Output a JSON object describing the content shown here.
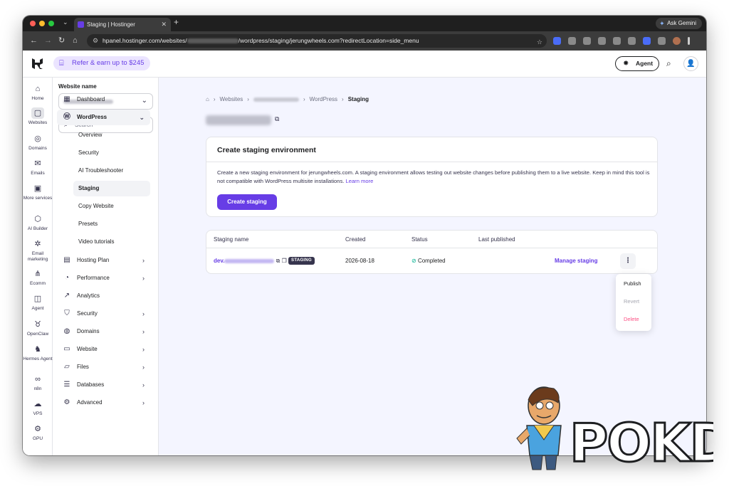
{
  "browser": {
    "tab_title": "Staging | Hostinger",
    "url_prefix": "hpanel.hostinger.com/websites/",
    "url_suffix": "/wordpress/staging/jerungwheels.com?redirectLocation=side_menu",
    "gemini_label": "Ask Gemini",
    "traffic_colors": [
      "#ff5f57",
      "#febc2e",
      "#28c840"
    ]
  },
  "header": {
    "refer_label": "Refer & earn up to $245",
    "agent_label": "Agent"
  },
  "rail": [
    {
      "label": "Home",
      "icon": "home-icon",
      "glyph": "⌂"
    },
    {
      "label": "Websites",
      "icon": "websites-icon",
      "glyph": "▢",
      "active": true
    },
    {
      "label": "Domains",
      "icon": "globe-icon",
      "glyph": "◎"
    },
    {
      "label": "Emails",
      "icon": "mail-icon",
      "glyph": "✉"
    },
    {
      "label": "More services",
      "icon": "box-icon",
      "glyph": "▣"
    },
    {
      "label": "AI Builder",
      "icon": "ai-builder-icon",
      "glyph": "⬡"
    },
    {
      "label": "Email marketing",
      "icon": "email-marketing-icon",
      "glyph": "✲"
    },
    {
      "label": "Ecomm",
      "icon": "ecomm-icon",
      "glyph": "⋔"
    },
    {
      "label": "Agent",
      "icon": "agent-icon",
      "glyph": "◫"
    },
    {
      "label": "OpenClaw",
      "icon": "openclaw-icon",
      "glyph": "♉"
    },
    {
      "label": "Hermes Agent",
      "icon": "hermes-icon",
      "glyph": "♞"
    },
    {
      "label": "n8n",
      "icon": "n8n-icon",
      "glyph": "∞"
    },
    {
      "label": "VPS",
      "icon": "vps-icon",
      "glyph": "☁"
    },
    {
      "label": "GPU",
      "icon": "gpu-icon",
      "glyph": "⚙"
    }
  ],
  "sidebar": {
    "website_label": "Website name",
    "search_placeholder": "Search",
    "items": [
      {
        "label": "Dashboard",
        "icon": "dashboard-icon",
        "glyph": "▦"
      },
      {
        "label": "WordPress",
        "icon": "wordpress-icon",
        "glyph": "Ⓦ",
        "open": true
      },
      {
        "label": "Hosting Plan",
        "icon": "hosting-plan-icon",
        "glyph": "▤"
      },
      {
        "label": "Performance",
        "icon": "performance-icon",
        "glyph": "◔"
      },
      {
        "label": "Analytics",
        "icon": "analytics-icon",
        "glyph": "↗"
      },
      {
        "label": "Security",
        "icon": "shield-icon",
        "glyph": "⛉"
      },
      {
        "label": "Domains",
        "icon": "globe-icon",
        "glyph": "◍"
      },
      {
        "label": "Website",
        "icon": "website-icon",
        "glyph": "▭"
      },
      {
        "label": "Files",
        "icon": "folder-icon",
        "glyph": "▱"
      },
      {
        "label": "Databases",
        "icon": "database-icon",
        "glyph": "☰"
      },
      {
        "label": "Advanced",
        "icon": "gear-icon",
        "glyph": "⚙"
      }
    ],
    "wordpress_sub": [
      {
        "label": "Overview"
      },
      {
        "label": "Security"
      },
      {
        "label": "AI Troubleshooter"
      },
      {
        "label": "Staging",
        "active": true
      },
      {
        "label": "Copy Website"
      },
      {
        "label": "Presets"
      },
      {
        "label": "Video tutorials"
      }
    ]
  },
  "breadcrumb": {
    "websites": "Websites",
    "wordpress": "WordPress",
    "current": "Staging"
  },
  "create_card": {
    "title": "Create staging environment",
    "description": "Create a new staging environment for jerungwheels.com. A staging environment allows testing out website changes before publishing them to a live website. Keep in mind this tool is not compatible with WordPress multisite installations.",
    "learn_more": "Learn more",
    "button": "Create staging"
  },
  "staging_table": {
    "columns": [
      "Staging name",
      "Created",
      "Status",
      "Last published"
    ],
    "rows": [
      {
        "name_prefix": "dev.",
        "badge": "STAGING",
        "created": "2026-08-18",
        "status": "Completed",
        "last_published": "",
        "action": "Manage staging"
      }
    ]
  },
  "row_menu": {
    "publish": "Publish",
    "revert": "Revert",
    "delete": "Delete"
  },
  "watermark": "POKDE.NET",
  "colors": {
    "accent": "#673de6",
    "success": "#00b090",
    "danger": "#fc5185"
  }
}
